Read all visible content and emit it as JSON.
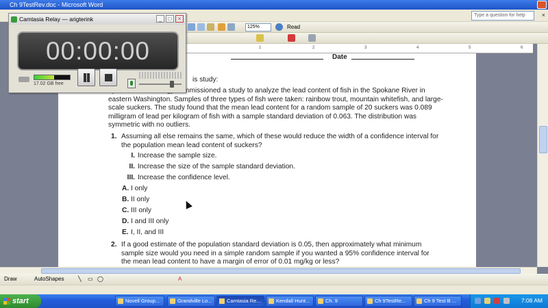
{
  "window": {
    "title": "Ch 9TestRev.doc - Microsoft Word",
    "help_placeholder": "Type a question for help",
    "zoom": "125%",
    "read_label": "Read"
  },
  "ruler_marks": [
    "1",
    "2",
    "3",
    "4",
    "5",
    "6"
  ],
  "drawing_toolbar": {
    "draw_label": "Draw",
    "autoshapes_label": "AutoShapes"
  },
  "camtasia": {
    "title": "Camtasia Relay — arigterink",
    "timer": "00:00:00",
    "disk_free": "17.02 GB free",
    "level": 0.55,
    "volume": 0.8
  },
  "document": {
    "date_label": "Date",
    "intro_tail": "is study:",
    "paragraph": "epartment of Ecology commissioned a study to analyze the lead content of fish in the Spokane River in eastern Washington. Samples of three types of fish were taken: rainbow trout, mountain whitefish, and large-scale suckers. The study found that the mean lead content for a random sample of 20 suckers was 0.089 milligram of lead per kilogram of fish with a sample standard deviation of 0.063. The distribution was symmetric with no outliers.",
    "questions": [
      {
        "num": "1.",
        "text": "Assuming all else remains the same, which of these would reduce the width of a confidence interval for the population mean lead content of suckers?",
        "statements": [
          {
            "rn": "I.",
            "text": "Increase the sample size."
          },
          {
            "rn": "II.",
            "text": "Increase the size of the sample standard deviation."
          },
          {
            "rn": "III.",
            "text": "Increase the confidence level."
          }
        ],
        "options": [
          {
            "letter": "A.",
            "text": "I only"
          },
          {
            "letter": "B.",
            "text": "II only"
          },
          {
            "letter": "C.",
            "text": "III only"
          },
          {
            "letter": "D.",
            "text": "I and III only"
          },
          {
            "letter": "E.",
            "text": "I, II, and III"
          }
        ]
      },
      {
        "num": "2.",
        "text": "If a good estimate of the population standard deviation is 0.05, then approximately what minimum sample size would you need in a simple random sample if you wanted a 95% confidence interval for the mean lead content to have a margin of error of 0.01 mg/kg or less?"
      }
    ]
  },
  "taskbar": {
    "start_label": "start",
    "items": [
      {
        "label": "Novell Group...",
        "active": false
      },
      {
        "label": "Grandville Lo...",
        "active": false
      },
      {
        "label": "Camtasia Re...",
        "active": true
      },
      {
        "label": "Kendall Hunt...",
        "active": false
      },
      {
        "label": "Ch. 9",
        "active": false
      },
      {
        "label": "Ch 9TestRe...",
        "active": false
      },
      {
        "label": "Ch 9 Test B ...",
        "active": false
      }
    ],
    "clock": "7:08 AM"
  }
}
